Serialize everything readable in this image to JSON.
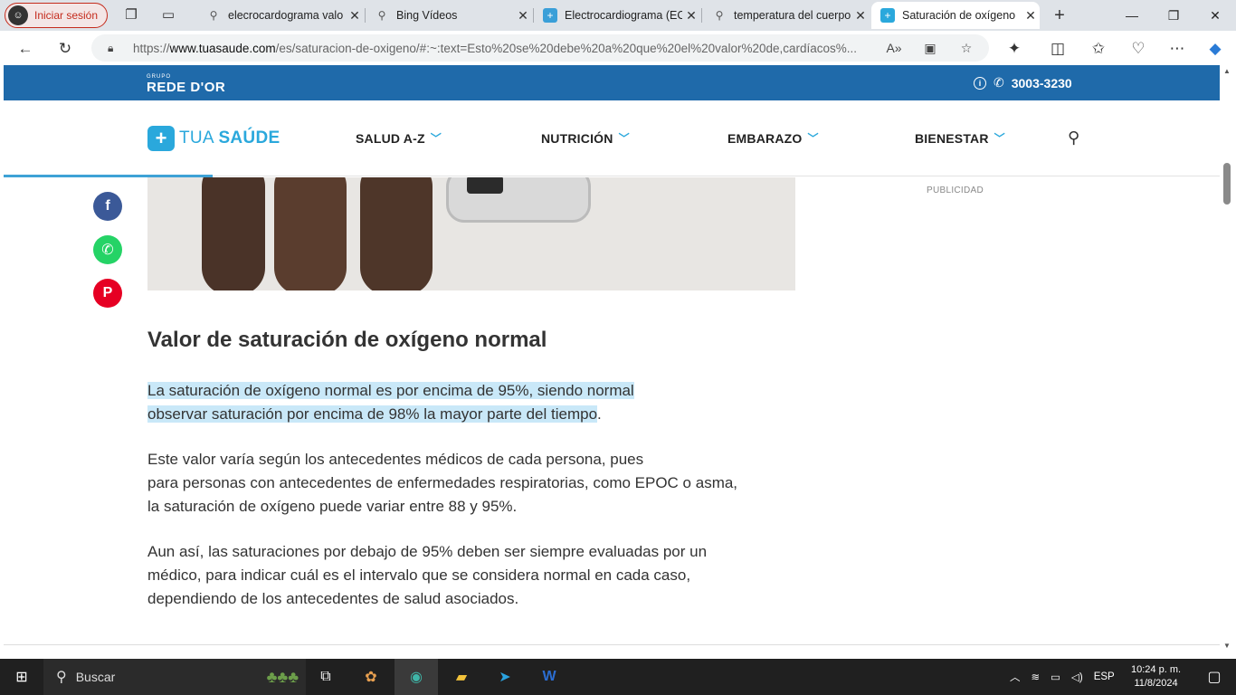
{
  "browser": {
    "profile_label": "Iniciar sesión",
    "tabs": [
      {
        "title": "elecrocardograma valo",
        "icon": "search-icon"
      },
      {
        "title": "Bing Vídeos",
        "icon": "search-icon"
      },
      {
        "title": "Electrocardiograma (EC",
        "icon": "site-icon"
      },
      {
        "title": "temperatura del cuerpo",
        "icon": "search-icon"
      },
      {
        "title": "Saturación de oxígeno",
        "icon": "tuasaude-icon",
        "active": true
      }
    ],
    "url_prefix": "https://",
    "url_host": "www.tuasaude.com",
    "url_rest": "/es/saturacion-de-oxigeno/#:~:text=Esto%20se%20debe%20a%20que%20el%20valor%20de,cardíacos%..."
  },
  "site": {
    "group_label": "GRUPO",
    "brand_label": "REDE D'OR",
    "phone": "3003-3230",
    "logo_text_1": "TUA ",
    "logo_text_2": "SAÚDE",
    "menu": [
      "SALUD A-Z",
      "NUTRICIÓN",
      "EMBARAZO",
      "BIENESTAR"
    ],
    "ad_label": "PUBLICIDAD"
  },
  "article": {
    "heading": "Valor de saturación de oxígeno normal",
    "p1_line1": "La saturación de oxígeno normal es por encima de 95%, siendo normal",
    "p1_line2": "observar saturación por encima de 98% la mayor parte del tiempo",
    "p1_end": ".",
    "p2_line1": "Este valor varía según los antecedentes médicos de cada persona, pues",
    "p2_line2": "para personas con antecedentes de enfermedades respiratorias, como EPOC o asma,",
    "p2_line3": "la saturación de oxígeno puede variar entre 88 y 95%.",
    "p3_line1": "Aun así, las saturaciones por debajo de 95% deben ser siempre evaluadas por un",
    "p3_line2": "médico, para indicar cuál es el intervalo que se considera normal en cada caso,",
    "p3_line3": "dependiendo de los antecedentes de salud asociados."
  },
  "taskbar": {
    "search_label": "Buscar",
    "lang": "ESP",
    "time": "10:24 p. m.",
    "date": "11/8/2024"
  },
  "colors": {
    "brand_blue": "#1f6aaa",
    "accent": "#2aa8dc",
    "highlight": "#c9e8f8",
    "facebook": "#3b5998",
    "whatsapp": "#25d366",
    "pinterest": "#e60023"
  }
}
